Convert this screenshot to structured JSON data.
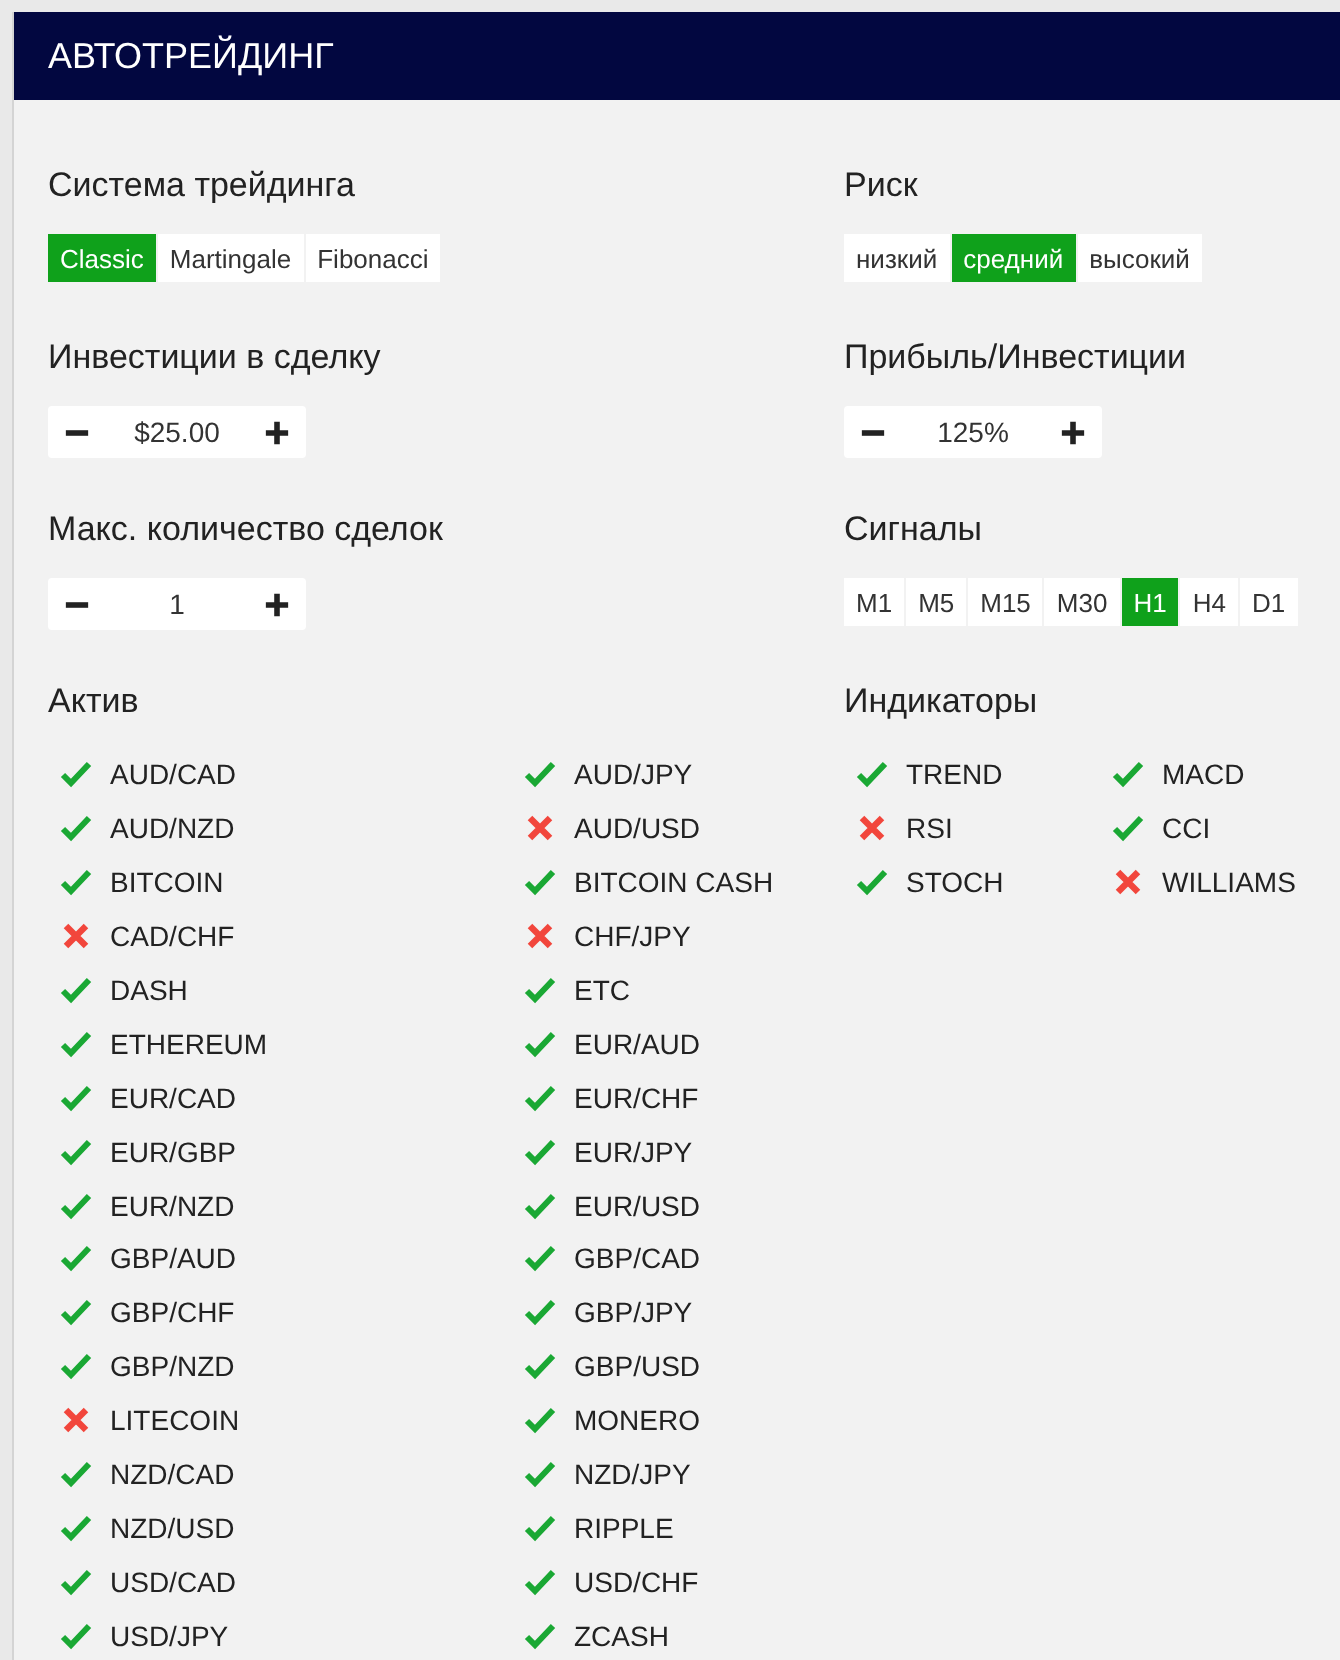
{
  "header": {
    "title": "АВТОТРЕЙДИНГ"
  },
  "trading_system": {
    "label": "Система трейдинга",
    "options": [
      {
        "label": "Classic",
        "selected": true
      },
      {
        "label": "Martingale",
        "selected": false
      },
      {
        "label": "Fibonacci",
        "selected": false
      }
    ]
  },
  "risk": {
    "label": "Риск",
    "options": [
      {
        "label": "низкий",
        "selected": false
      },
      {
        "label": "средний",
        "selected": true
      },
      {
        "label": "высокий",
        "selected": false
      }
    ]
  },
  "investment": {
    "label": "Инвестиции в сделку",
    "value": "$25.00"
  },
  "profit": {
    "label": "Прибыль/Инвестиции",
    "value": "125%"
  },
  "max_deals": {
    "label": "Макс. количество сделок",
    "value": "1"
  },
  "signals": {
    "label": "Сигналы",
    "options": [
      {
        "label": "M1",
        "selected": false
      },
      {
        "label": "M5",
        "selected": false
      },
      {
        "label": "M15",
        "selected": false
      },
      {
        "label": "M30",
        "selected": false
      },
      {
        "label": "H1",
        "selected": true
      },
      {
        "label": "H4",
        "selected": false
      },
      {
        "label": "D1",
        "selected": false
      }
    ]
  },
  "assets": {
    "label": "Актив",
    "items": [
      {
        "name": "AUD/CAD",
        "enabled": true
      },
      {
        "name": "AUD/JPY",
        "enabled": true
      },
      {
        "name": "AUD/NZD",
        "enabled": true
      },
      {
        "name": "AUD/USD",
        "enabled": false
      },
      {
        "name": "BITCOIN",
        "enabled": true
      },
      {
        "name": "BITCOIN CASH",
        "enabled": true
      },
      {
        "name": "CAD/CHF",
        "enabled": false
      },
      {
        "name": "CHF/JPY",
        "enabled": false
      },
      {
        "name": "DASH",
        "enabled": true
      },
      {
        "name": "ETC",
        "enabled": true
      },
      {
        "name": "ETHEREUM",
        "enabled": true
      },
      {
        "name": "EUR/AUD",
        "enabled": true
      },
      {
        "name": "EUR/CAD",
        "enabled": true
      },
      {
        "name": "EUR/CHF",
        "enabled": true
      },
      {
        "name": "EUR/GBP",
        "enabled": true
      },
      {
        "name": "EUR/JPY",
        "enabled": true
      },
      {
        "name": "EUR/NZD",
        "enabled": true
      },
      {
        "name": "EUR/USD",
        "enabled": true
      },
      {
        "name": "GBP/AUD",
        "enabled": true
      },
      {
        "name": "GBP/CAD",
        "enabled": true
      },
      {
        "name": "GBP/CHF",
        "enabled": true
      },
      {
        "name": "GBP/JPY",
        "enabled": true
      },
      {
        "name": "GBP/NZD",
        "enabled": true
      },
      {
        "name": "GBP/USD",
        "enabled": true
      },
      {
        "name": "LITECOIN",
        "enabled": false
      },
      {
        "name": "MONERO",
        "enabled": true
      },
      {
        "name": "NZD/CAD",
        "enabled": true
      },
      {
        "name": "NZD/JPY",
        "enabled": true
      },
      {
        "name": "NZD/USD",
        "enabled": true
      },
      {
        "name": "RIPPLE",
        "enabled": true
      },
      {
        "name": "USD/CAD",
        "enabled": true
      },
      {
        "name": "USD/CHF",
        "enabled": true
      },
      {
        "name": "USD/JPY",
        "enabled": true
      },
      {
        "name": "ZCASH",
        "enabled": true
      }
    ]
  },
  "indicators": {
    "label": "Индикаторы",
    "items": [
      {
        "name": "TREND",
        "enabled": true
      },
      {
        "name": "MACD",
        "enabled": true
      },
      {
        "name": "RSI",
        "enabled": false
      },
      {
        "name": "CCI",
        "enabled": true
      },
      {
        "name": "STOCH",
        "enabled": true
      },
      {
        "name": "WILLIAMS",
        "enabled": false
      }
    ]
  }
}
